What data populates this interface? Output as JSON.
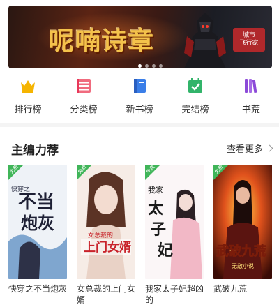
{
  "banner": {
    "title": "呢喃诗章",
    "badge_line1": "城市",
    "badge_line2": "飞行家",
    "dots": 4,
    "active_dot": 0
  },
  "nav": [
    {
      "label": "排行榜",
      "icon": "crown-icon",
      "color": "#f5b400"
    },
    {
      "label": "分类榜",
      "icon": "category-icon",
      "color": "#e8385a"
    },
    {
      "label": "新书榜",
      "icon": "new-book-icon",
      "color": "#3a7ee8"
    },
    {
      "label": "完结榜",
      "icon": "calendar-check-icon",
      "color": "#32b46a"
    },
    {
      "label": "书荒",
      "icon": "bookshelf-icon",
      "color": "#8c4ad8"
    }
  ],
  "section": {
    "title": "主编力荐",
    "more_label": "查看更多"
  },
  "books": [
    {
      "title": "快穿之不当炮灰",
      "tag": "免费",
      "cover_text": "不当炮灰",
      "cover_sub": "快穿之"
    },
    {
      "title": "女总裁的上门女婿",
      "tag": "免费",
      "cover_text": "上门女婿",
      "cover_sub": "女总裁的"
    },
    {
      "title": "我家太子妃超凶的",
      "tag": "免费",
      "cover_text": "太子妃",
      "cover_sub": "我家"
    },
    {
      "title": "武破九荒",
      "tag": "免费",
      "cover_text": "武破九荒",
      "cover_sub": "无敌小说"
    }
  ]
}
